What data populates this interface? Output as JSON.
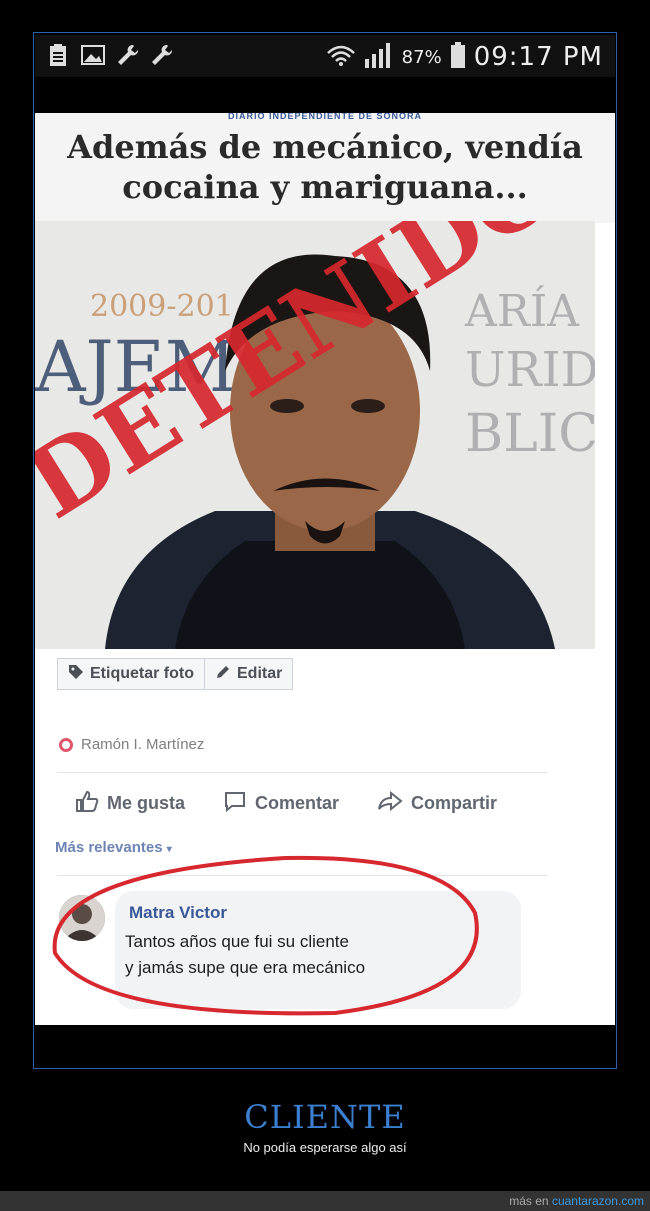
{
  "status_bar": {
    "icons_left": [
      "clipboard-icon",
      "image-icon",
      "wrench-icon",
      "wrench-icon"
    ],
    "battery_pct": "87%",
    "time": "09:17 PM"
  },
  "post": {
    "masthead": "DIARIO INDEPENDIENTE DE SONORA",
    "headline_line1": "Además de mecánico, vendía",
    "headline_line2": "cocaina y mariguana...",
    "stamp_text": "DETENIDO",
    "backdrop_text": {
      "years": "2009-201",
      "left_word": "AJEMI",
      "right_word1": "ARÍA",
      "right_word2": "URIDA",
      "right_word3": "BLIC"
    },
    "tag_photo_label": "Etiquetar foto",
    "edit_label": "Editar",
    "author": "Ramón I. Martínez",
    "like_label": "Me gusta",
    "comment_label": "Comentar",
    "share_label": "Compartir",
    "sort_label": "Más relevantes",
    "comment": {
      "author": "Matra Victor",
      "line1": "Tantos años que fui su cliente",
      "line2": "y jamás supe que era mecánico"
    }
  },
  "caption": {
    "title": "CLIENTE",
    "subtitle": "No podía esperarse algo así"
  },
  "footer": {
    "prefix": "más en",
    "link": "cuantarazon.com"
  },
  "colors": {
    "stamp_red": "#d6282e",
    "caption_blue": "#3b7fd1",
    "fb_link_blue": "#385898"
  }
}
